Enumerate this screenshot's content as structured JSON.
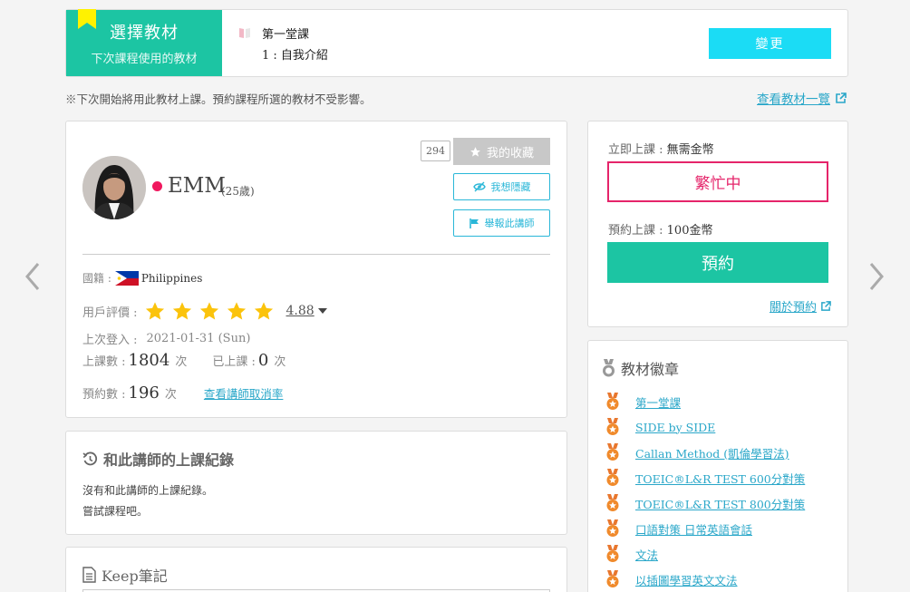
{
  "banner": {
    "title": "選擇教材",
    "subtitle": "下次課程使用的教材",
    "lesson_line1": "第一堂課",
    "lesson_line2": "1 : 自我介紹",
    "change_label": "變更"
  },
  "notice": "※下次開始將用此教材上課。預約課程所選的教材不受影響。",
  "materials_link": "查看教材一覽",
  "teacher": {
    "name": "EMM",
    "age": "(25歲)",
    "favorite_count": "294",
    "favorite_label": "我的收藏",
    "hide_label": "我想隱藏",
    "report_label": "舉報此講師",
    "country_label": "國籍 :",
    "country": "Philippines",
    "rating_label": "用戶評價 :",
    "rating": "4.88",
    "rating_stars": 5,
    "last_login_label": "上次登入 :",
    "last_login": "2021-01-31 (Sun)",
    "lessons_label": "上課數 :",
    "lessons": "1804",
    "times_unit": "次",
    "taken_label": "已上課 :",
    "taken": "0",
    "reservations_label": "預約數 :",
    "reservations": "196",
    "cancel_rate_link": "查看講師取消率"
  },
  "history": {
    "title": "和此講師的上課紀錄",
    "line1": "沒有和此講師的上課紀錄。",
    "line2": "嘗試課程吧。"
  },
  "keep": {
    "title": "Keep筆記"
  },
  "booking": {
    "instant_label": "立即上課 :",
    "instant_value": "無需金幣",
    "busy_label": "繁忙中",
    "reserve_label": "預約上課 :",
    "reserve_value": "100金幣",
    "reserve_button": "預約",
    "about_link": "關於預約"
  },
  "badges": {
    "title": "教材徽章",
    "items": [
      "第一堂課",
      "SIDE by SIDE",
      "Callan Method (凱倫學習法)",
      "TOEIC®L&R TEST 600分對策",
      "TOEIC®L&R TEST 800分對策",
      "口語對策 日常英語會話",
      "文法",
      "以插圖學習英文文法"
    ]
  },
  "colors": {
    "accent": "#1cc5a3",
    "change_button": "#1bdcf5",
    "busy": "#e5246a",
    "link": "#2aa7c9",
    "online": "#f0185e"
  }
}
